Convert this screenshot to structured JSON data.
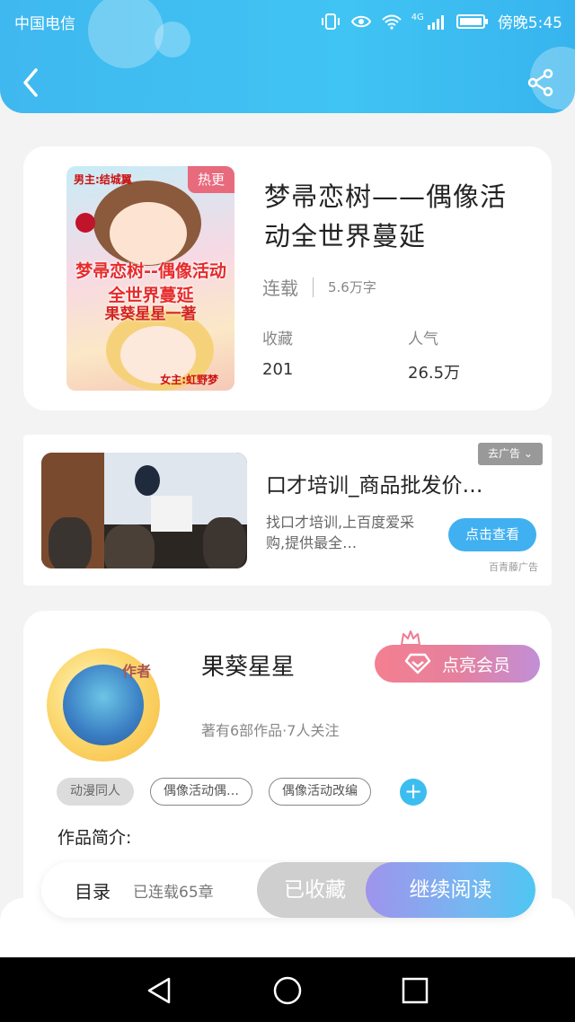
{
  "status_bar": {
    "carrier": "中国电信",
    "time": "傍晚5:45",
    "network": "4G"
  },
  "book": {
    "title": "梦帚恋树——偶像活动全世界蔓延",
    "badge": "热更",
    "status": "连载",
    "words": "5.6万字",
    "favorites_label": "收藏",
    "favorites_value": "201",
    "popularity_label": "人气",
    "popularity_value": "26.5万",
    "cover": {
      "top_text": "男主:结城翼",
      "title_text": "梦帚恋树--偶像活动全世界蔓延",
      "author_text": "果葵星星一著",
      "bottom_text": "女主:虹野梦"
    }
  },
  "ad": {
    "title": "口才培训_商品批发价…",
    "desc": "找口才培训,上百度爱采购,提供最全…",
    "button": "点击查看",
    "close": "去广告",
    "source": "百青藤广告"
  },
  "author": {
    "name": "果葵星星",
    "avatar_badge": "作者",
    "meta": "著有6部作品·7人关注",
    "vip_button": "点亮会员",
    "tags": [
      "动漫同人",
      "偶像活动偶…",
      "偶像活动改编"
    ],
    "intro_label": "作品简介:"
  },
  "bottom_bar": {
    "toc": "目录",
    "chapters": "已连载65章",
    "fav": "已收藏",
    "read": "继续阅读"
  },
  "colors": {
    "header": "#3fb8ef",
    "accent_blue": "#41b0f0",
    "vip_pink": "#f47f90",
    "read_purple": "#9f94ec"
  },
  "icons": [
    "back-arrow-icon",
    "share-icon",
    "diamond-icon",
    "crown-icon",
    "plus-icon",
    "nav-back-icon",
    "nav-home-icon",
    "nav-recent-icon"
  ]
}
